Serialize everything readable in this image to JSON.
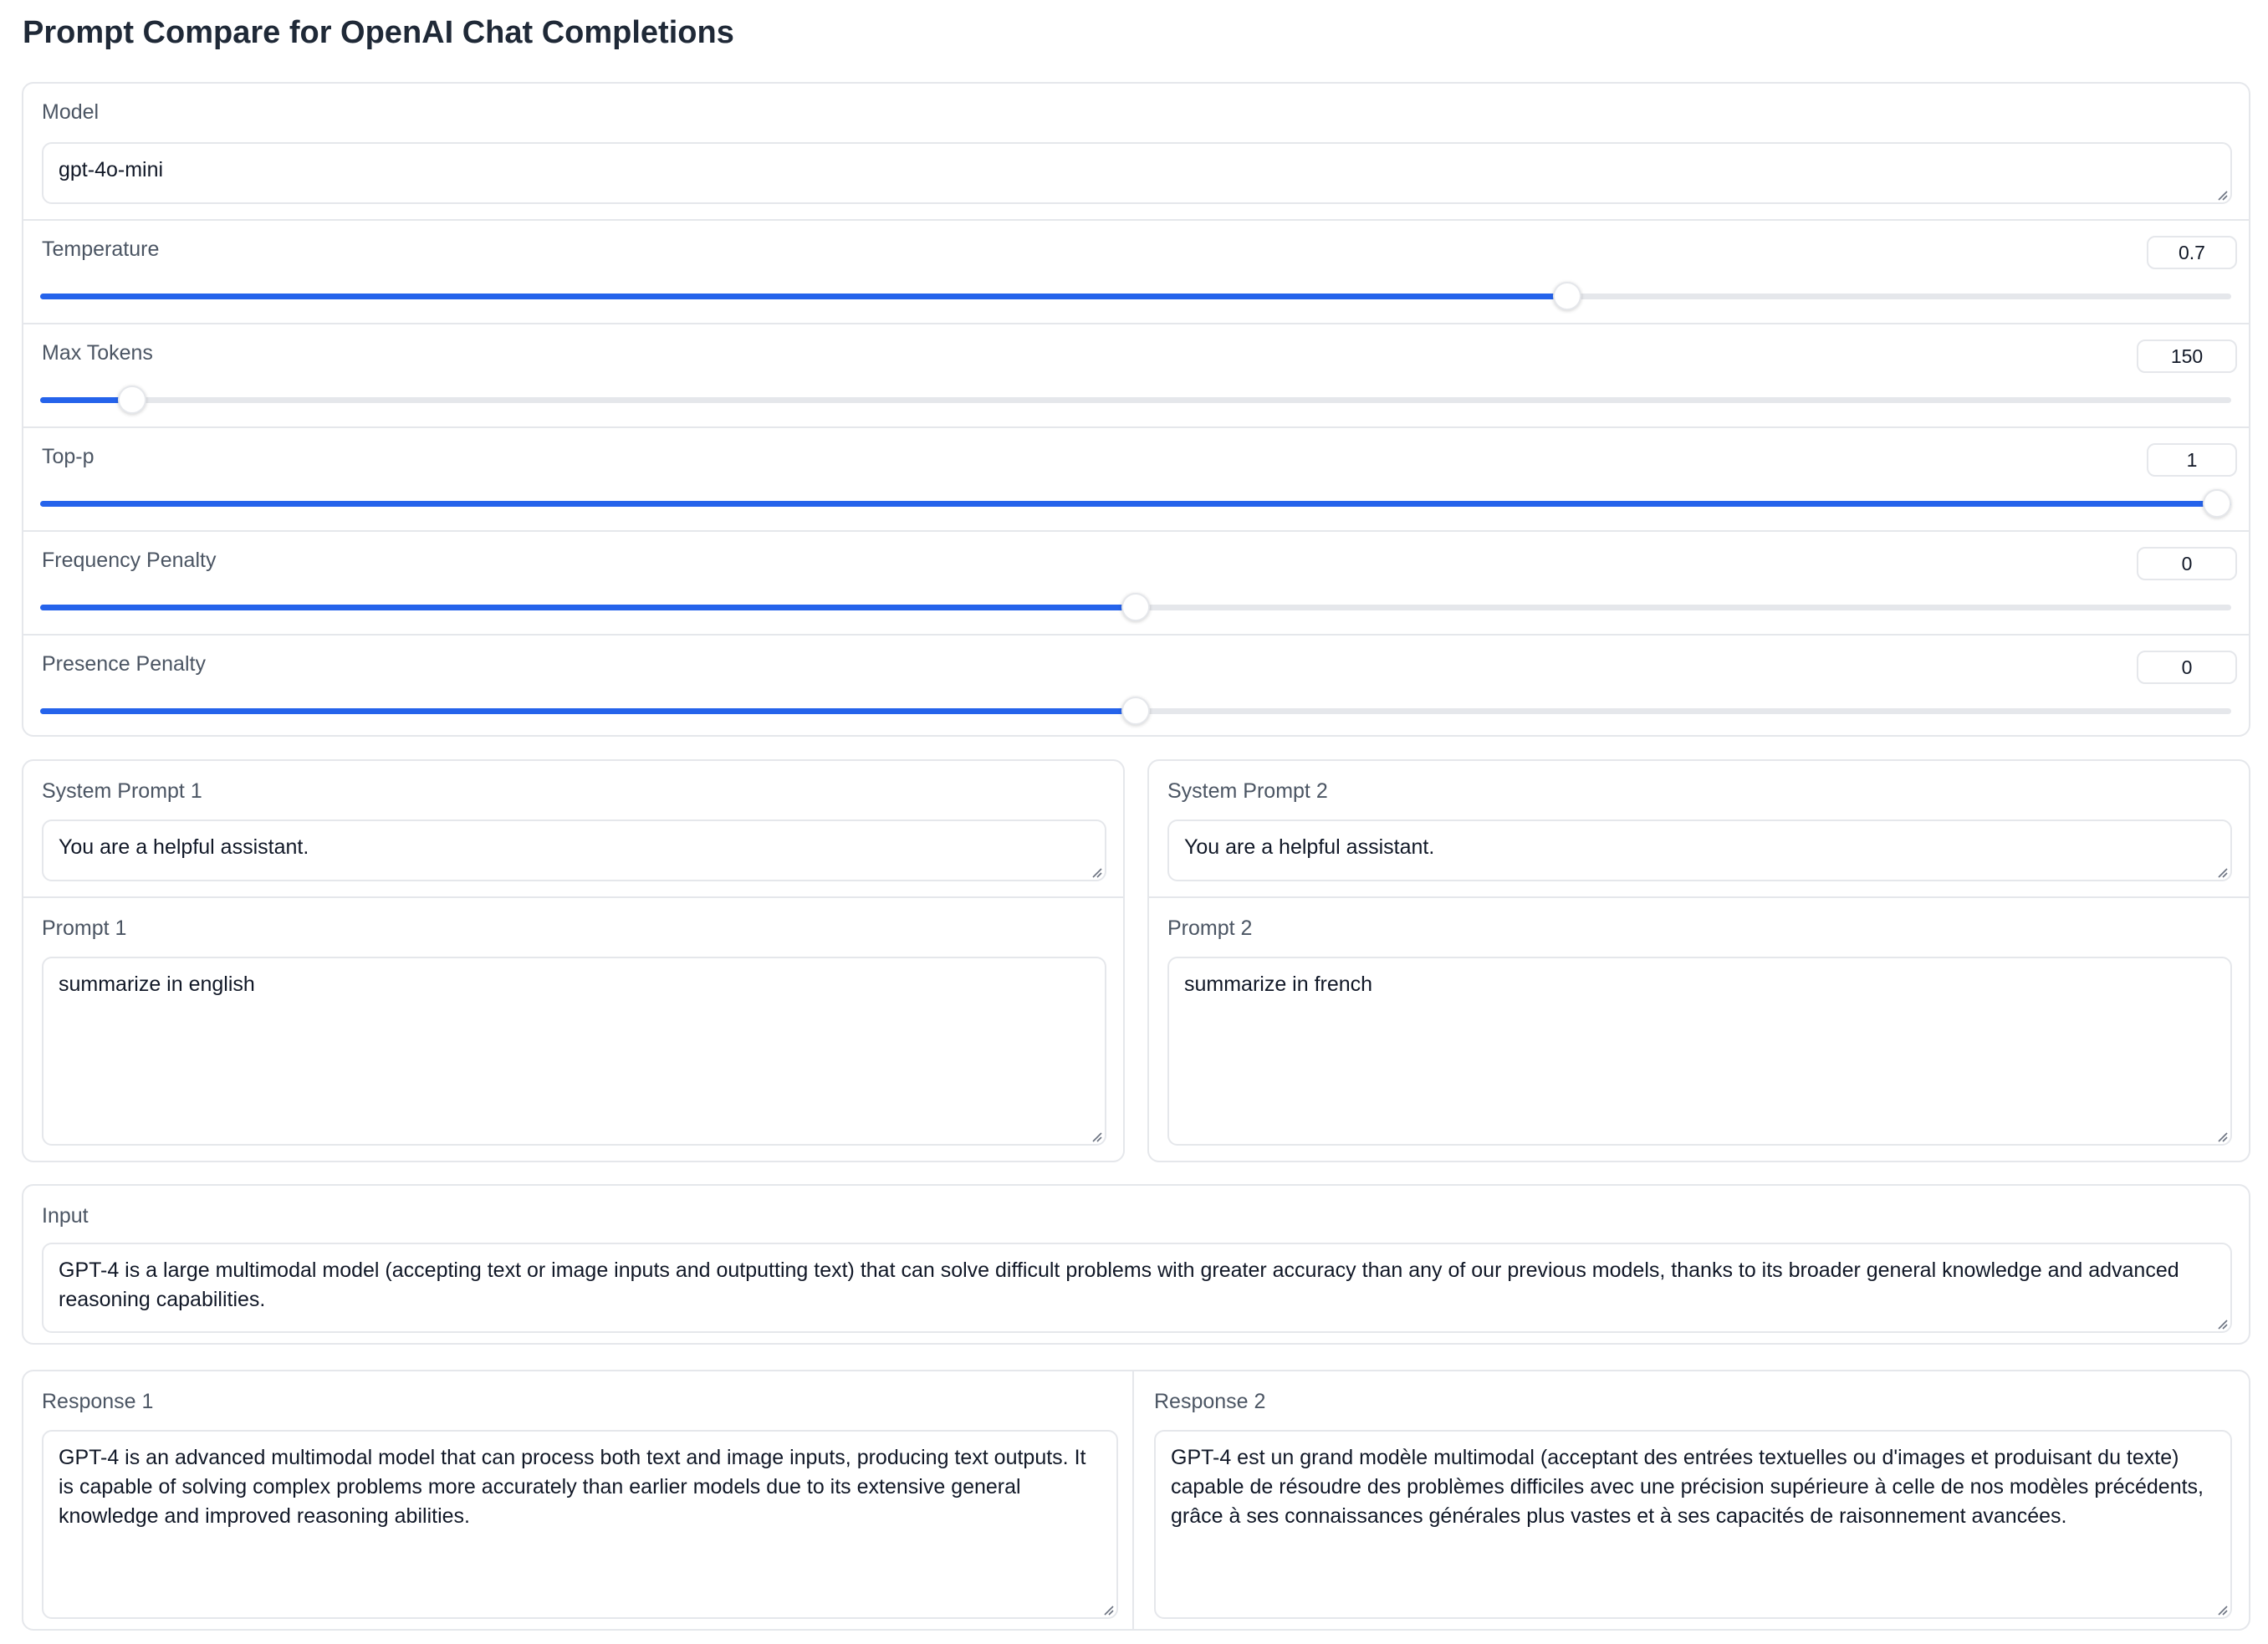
{
  "title": "Prompt Compare for OpenAI Chat Completions",
  "model": {
    "label": "Model",
    "value": "gpt-4o-mini"
  },
  "sliders": [
    {
      "label": "Temperature",
      "value": "0.7",
      "fraction": 0.697
    },
    {
      "label": "Max Tokens",
      "value": "150",
      "fraction": 0.042
    },
    {
      "label": "Top-p",
      "value": "1",
      "fraction": 1.0
    },
    {
      "label": "Frequency Penalty",
      "value": "0",
      "fraction": 0.5
    },
    {
      "label": "Presence Penalty",
      "value": "0",
      "fraction": 0.5
    }
  ],
  "left": {
    "system_label": "System Prompt 1",
    "system_value": "You are a helpful assistant.",
    "prompt_label": "Prompt 1",
    "prompt_value": "summarize in english"
  },
  "right": {
    "system_label": "System Prompt 2",
    "system_value": "You are a helpful assistant.",
    "prompt_label": "Prompt 2",
    "prompt_value": "summarize in french"
  },
  "input": {
    "label": "Input",
    "value": "GPT-4 is a large multimodal model (accepting text or image inputs and outputting text) that can solve difficult problems with greater accuracy than any of our previous models, thanks to its broader general knowledge and advanced reasoning capabilities."
  },
  "responses": [
    {
      "label": "Response 1",
      "value": "GPT-4 is an advanced multimodal model that can process both text and image inputs, producing text outputs. It is capable of solving complex problems more accurately than earlier models due to its extensive general knowledge and improved reasoning abilities."
    },
    {
      "label": "Response 2",
      "value": "GPT-4 est un grand modèle multimodal (acceptant des entrées textuelles ou d'images et produisant du texte) capable de résoudre des problèmes difficiles avec une précision supérieure à celle de nos modèles précédents, grâce à ses connaissances générales plus vastes et à ses capacités de raisonnement avancées."
    }
  ],
  "colors": {
    "accent": "#2563eb",
    "border": "#e5e7eb",
    "label": "#4b5563"
  }
}
